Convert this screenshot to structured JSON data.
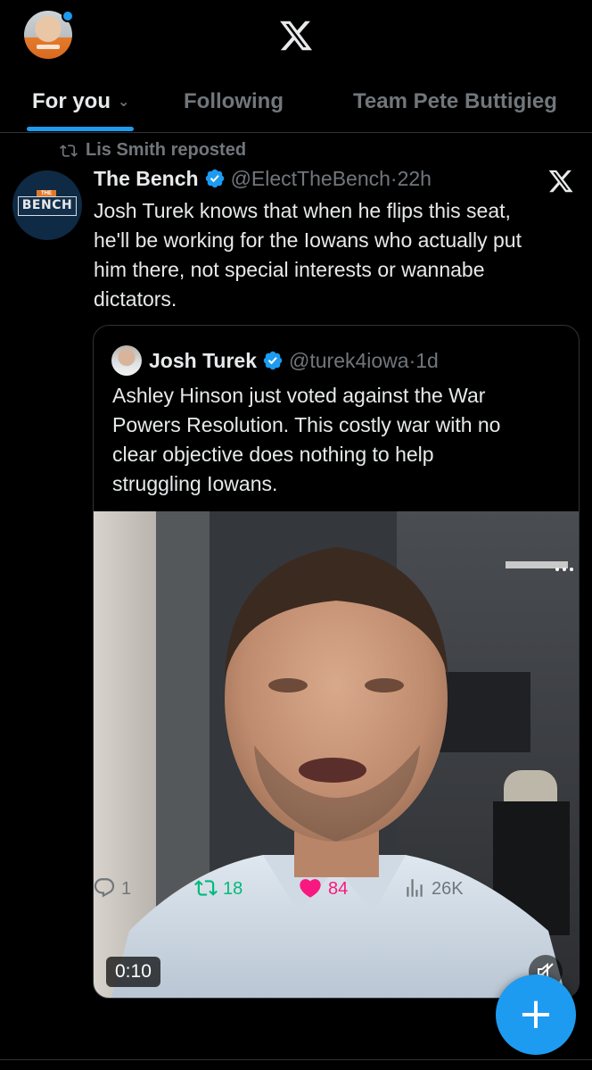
{
  "header": {
    "logo": "x-logo",
    "profile_icon": "profile-avatar",
    "notification_dot_color": "#1d9bf0"
  },
  "tabs": [
    {
      "label": "For you",
      "active": true
    },
    {
      "label": "Following",
      "active": false
    },
    {
      "label": "Team Pete Buttigieg",
      "active": false
    }
  ],
  "post": {
    "repost_label": "Lis Smith reposted",
    "author_name": "The Bench",
    "author_handle": "@ElectTheBench",
    "separator": "·",
    "time": "22h",
    "avatar_logo_text": "BENCH",
    "avatar_logo_small": "THE",
    "text": "Josh Turek knows that when he flips this seat,\nhe'll be working for the Iowans who actually put\nhim there, not special interests or wannabe\ndictators.",
    "quote": {
      "author_name": "Josh Turek",
      "author_handle": "@turek4iowa",
      "separator": "·",
      "time": "1d",
      "text": "Ashley Hinson just voted against the War\nPowers Resolution. This costly war with no\nclear objective does nothing to help\nstruggling Iowans.",
      "video": {
        "duration": "0:10",
        "muted": true
      }
    },
    "actions": {
      "replies": "1",
      "reposts": "18",
      "likes": "84",
      "views": "26K"
    }
  },
  "fab": {
    "label": "+",
    "icon": "compose-plus-icon"
  },
  "colors": {
    "accent": "#1d9bf0",
    "repost": "#00ba7c",
    "like": "#f91880",
    "muted_text": "#71767b",
    "text": "#e7e9ea",
    "background": "#000000",
    "border": "#2f3336"
  }
}
